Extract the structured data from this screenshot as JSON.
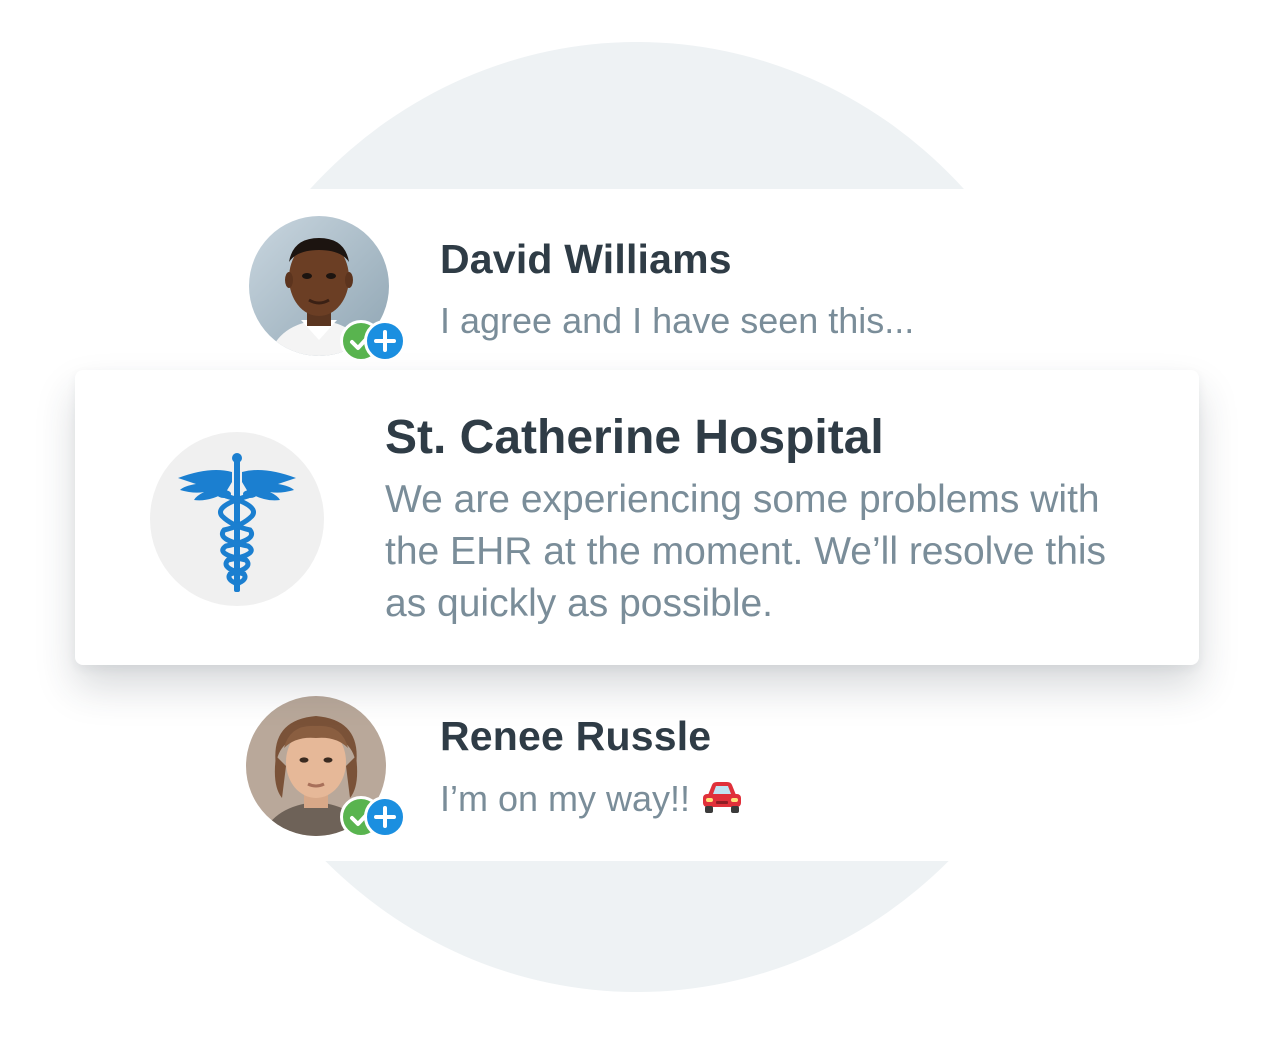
{
  "conversations": [
    {
      "name": "David Williams",
      "preview": "I agree and I have seen this...",
      "avatar": "person-avatar",
      "badges": [
        "verified-check-icon",
        "add-plus-icon"
      ]
    },
    {
      "name": "St. Catherine Hospital",
      "preview": "We are experiencing some problems with the EHR at the moment. We’ll resolve this as quickly as possible.",
      "avatar": "caduceus-icon",
      "highlighted": true
    },
    {
      "name": "Renee Russle",
      "preview": "I’m on my way!!",
      "preview_emoji": "car-icon",
      "avatar": "person-avatar",
      "badges": [
        "verified-check-icon",
        "add-plus-icon"
      ]
    }
  ],
  "colors": {
    "name_text": "#2f3c46",
    "preview_text": "#7a8d99",
    "verified_badge": "#59b44f",
    "add_badge": "#1b8fe0",
    "caduceus": "#1b7fd0",
    "background_circle": "#eef2f4"
  }
}
